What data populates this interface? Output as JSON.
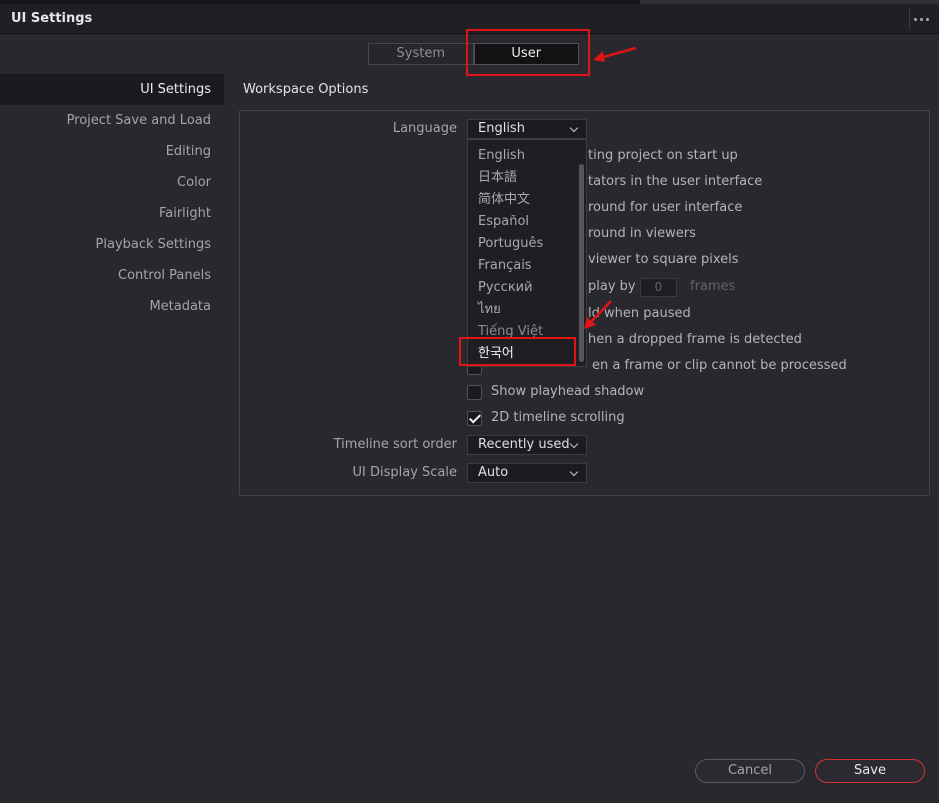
{
  "window": {
    "title": "UI Settings"
  },
  "tabs": [
    {
      "label": "System",
      "active": false
    },
    {
      "label": "User",
      "active": true
    }
  ],
  "sidebar": {
    "items": [
      {
        "label": "UI Settings",
        "active": true
      },
      {
        "label": "Project Save and Load"
      },
      {
        "label": "Editing"
      },
      {
        "label": "Color"
      },
      {
        "label": "Fairlight"
      },
      {
        "label": "Playback Settings"
      },
      {
        "label": "Control Panels"
      },
      {
        "label": "Metadata"
      }
    ]
  },
  "section": {
    "title": "Workspace Options"
  },
  "language": {
    "label": "Language",
    "value": "English",
    "options": [
      "English",
      "日本語",
      "简体中文",
      "Español",
      "Português",
      "Français",
      "Русский",
      "ไทย",
      "Tiếng Việt",
      "한국어"
    ]
  },
  "options": {
    "reload_project": "ting project on start up",
    "indicators": "tators in the user interface",
    "bg_ui": "round for user interface",
    "bg_viewers": "round in viewers",
    "square_pixels": "viewer to square pixels",
    "display_by": "play by",
    "display_by_value": "0",
    "display_by_unit": "frames",
    "paused": "ld when paused",
    "dropped_frame": "hen a dropped frame is detected",
    "clip_cannot": "en a frame or clip cannot be processed",
    "playhead_shadow": "Show playhead shadow",
    "timeline_scrolling": "2D timeline scrolling"
  },
  "timeline_sort": {
    "label": "Timeline sort order",
    "value": "Recently used"
  },
  "ui_scale": {
    "label": "UI Display Scale",
    "value": "Auto"
  },
  "buttons": {
    "cancel": "Cancel",
    "save": "Save"
  },
  "colors": {
    "annotation_red": "#e01414",
    "save_border": "#d13434"
  }
}
